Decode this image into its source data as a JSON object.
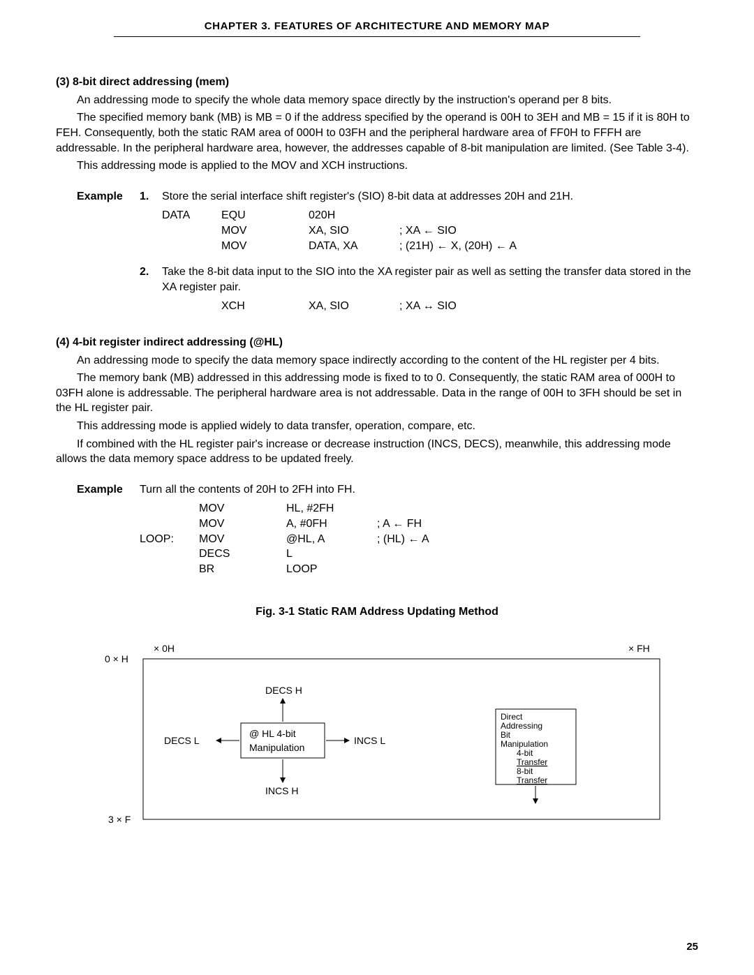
{
  "header": "CHAPTER  3.   FEATURES  OF  ARCHITECTURE  AND  MEMORY  MAP",
  "sec3": {
    "title": "(3)   8-bit direct addressing (mem)",
    "p1": "An addressing mode to specify the whole data memory space directly by the instruction's operand per 8 bits.",
    "p2": "The specified memory bank (MB) is MB = 0 if the address specified by the operand is 00H to 3EH and MB = 15 if it is 80H to FEH. Consequently, both the static RAM area of 000H to 03FH and the peripheral hardware area of FF0H to FFFH are addressable. In the peripheral hardware area, however, the addresses capable of 8-bit manipulation are limited. (See Table 3-4).",
    "p3": "This addressing mode is applied to the MOV and XCH instructions."
  },
  "ex_label": "Example",
  "sec3_ex1": {
    "num": "1.",
    "desc": "Store the serial interface shift register's (SIO) 8-bit data at addresses 20H and 21H.",
    "code": [
      {
        "label": "DATA",
        "op": "EQU",
        "arg": "020H",
        "comment": ""
      },
      {
        "label": "",
        "op": "MOV",
        "arg": "XA, SIO",
        "comment": "; XA ← SIO"
      },
      {
        "label": "",
        "op": "MOV",
        "arg": "DATA, XA",
        "comment": "; (21H) ← X, (20H) ← A"
      }
    ]
  },
  "sec3_ex2": {
    "num": "2.",
    "desc": "Take the 8-bit data input to the SIO into the XA register pair as well as setting the transfer data stored in the XA register pair.",
    "code": [
      {
        "label": "",
        "op": "XCH",
        "arg": "XA, SIO",
        "comment": "; XA ↔ SIO"
      }
    ]
  },
  "sec4": {
    "title": "(4)   4-bit register indirect addressing (@HL)",
    "p1": "An addressing mode to specify the data memory space indirectly according to the content of the HL register per 4 bits.",
    "p2": "The memory bank (MB) addressed in this addressing mode is fixed to to 0. Consequently, the static RAM area of 000H to 03FH alone is addressable. The peripheral hardware area is not addressable. Data in the range of 00H to 3FH should be set in the HL register pair.",
    "p3": "This addressing mode is applied widely to data transfer, operation, compare, etc.",
    "p4": "If combined with the HL register pair's increase or decrease instruction (INCS, DECS), meanwhile, this addressing mode allows the data memory space address to be updated freely."
  },
  "sec4_ex": {
    "desc": "Turn all the contents of 20H to 2FH into FH.",
    "code": [
      {
        "label": "",
        "op": "MOV",
        "arg": "HL, #2FH",
        "comment": ""
      },
      {
        "label": "",
        "op": "MOV",
        "arg": "A, #0FH",
        "comment": "; A ← FH"
      },
      {
        "label": "LOOP:",
        "op": "MOV",
        "arg": "@HL, A",
        "comment": "; (HL) ← A"
      },
      {
        "label": "",
        "op": "DECS",
        "arg": "L",
        "comment": ""
      },
      {
        "label": "",
        "op": "BR",
        "arg": "LOOP",
        "comment": ""
      }
    ]
  },
  "figure": {
    "title": "Fig. 3-1 Static RAM Address Updating Method",
    "tl_label": "× 0H",
    "tr_label": "× FH",
    "row_top": "0 × H",
    "row_bot": "3 × F",
    "decs_h": "DECS H",
    "incs_h": "INCS H",
    "decs_l": "DECS L",
    "incs_l": "INCS L",
    "center_l1": "@ HL 4-bit",
    "center_l2": "Manipulation",
    "box_l1": "Direct",
    "box_l2": "Addressing",
    "box_l3": "Bit",
    "box_l4": "Manipulation",
    "box_l5": "4-bit",
    "box_l6": "Transfer",
    "box_l7": "8-bit",
    "box_l8": "Transfer"
  },
  "page_number": "25"
}
